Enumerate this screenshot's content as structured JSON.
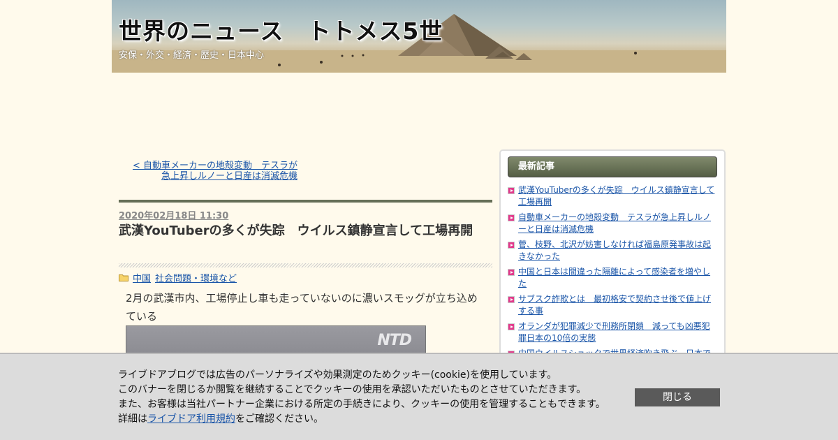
{
  "header": {
    "title": "世界のニュース　トトメス5世",
    "description": "安保・外交・経済・歴史・日本中心"
  },
  "nav": {
    "prev_link": "< 自動車メーカーの地殻変動　テスラが急上昇しルノーと日産は消滅危機"
  },
  "article": {
    "date": "2020年02月18日 11:30",
    "title": "武漢YouTuberの多くが失踪　ウイルス鎮静宣言して工場再開",
    "categories": [
      "中国",
      "社会問題・環境など"
    ],
    "body": "2月の武漢市内、工場停止し車も走っていないのに濃いスモッグが立ち込めている",
    "video_logo": "NTD"
  },
  "sidebar": {
    "heading": "最新記事",
    "items": [
      "武漢YouTuberの多くが失踪　ウイルス鎮静宣言して工場再開",
      "自動車メーカーの地殻変動　テスラが急上昇しルノーと日産は消滅危機",
      "菅、枝野、北沢が妨害しなければ福島原発事故は起きなかった",
      "中国と日本は間違った隔離によって感染者を増やした",
      "サブスク詐欺とは　最初格安で契約させ後で値上げする事",
      "オランダが犯罪減少で刑務所閉鎖　減っても凶悪犯罪日本の10倍の実態",
      "中国ウイルスショックで世界経済吹き飛ぶ　日本で"
    ]
  },
  "cookie": {
    "line1": "ライブドアブログでは広告のパーソナライズや効果測定のためクッキー(cookie)を使用しています。",
    "line2": "このバナーを閉じるか閲覧を継続することでクッキーの使用を承認いただいたものとさせていただきます。",
    "line3": "また、お客様は当社パートナー企業における所定の手続きにより、クッキーの使用を管理することもできます。",
    "line4_prefix": "詳細は",
    "line4_link": "ライブドア利用規約",
    "line4_suffix": "をご確認ください。",
    "close_label": "閉じる"
  }
}
